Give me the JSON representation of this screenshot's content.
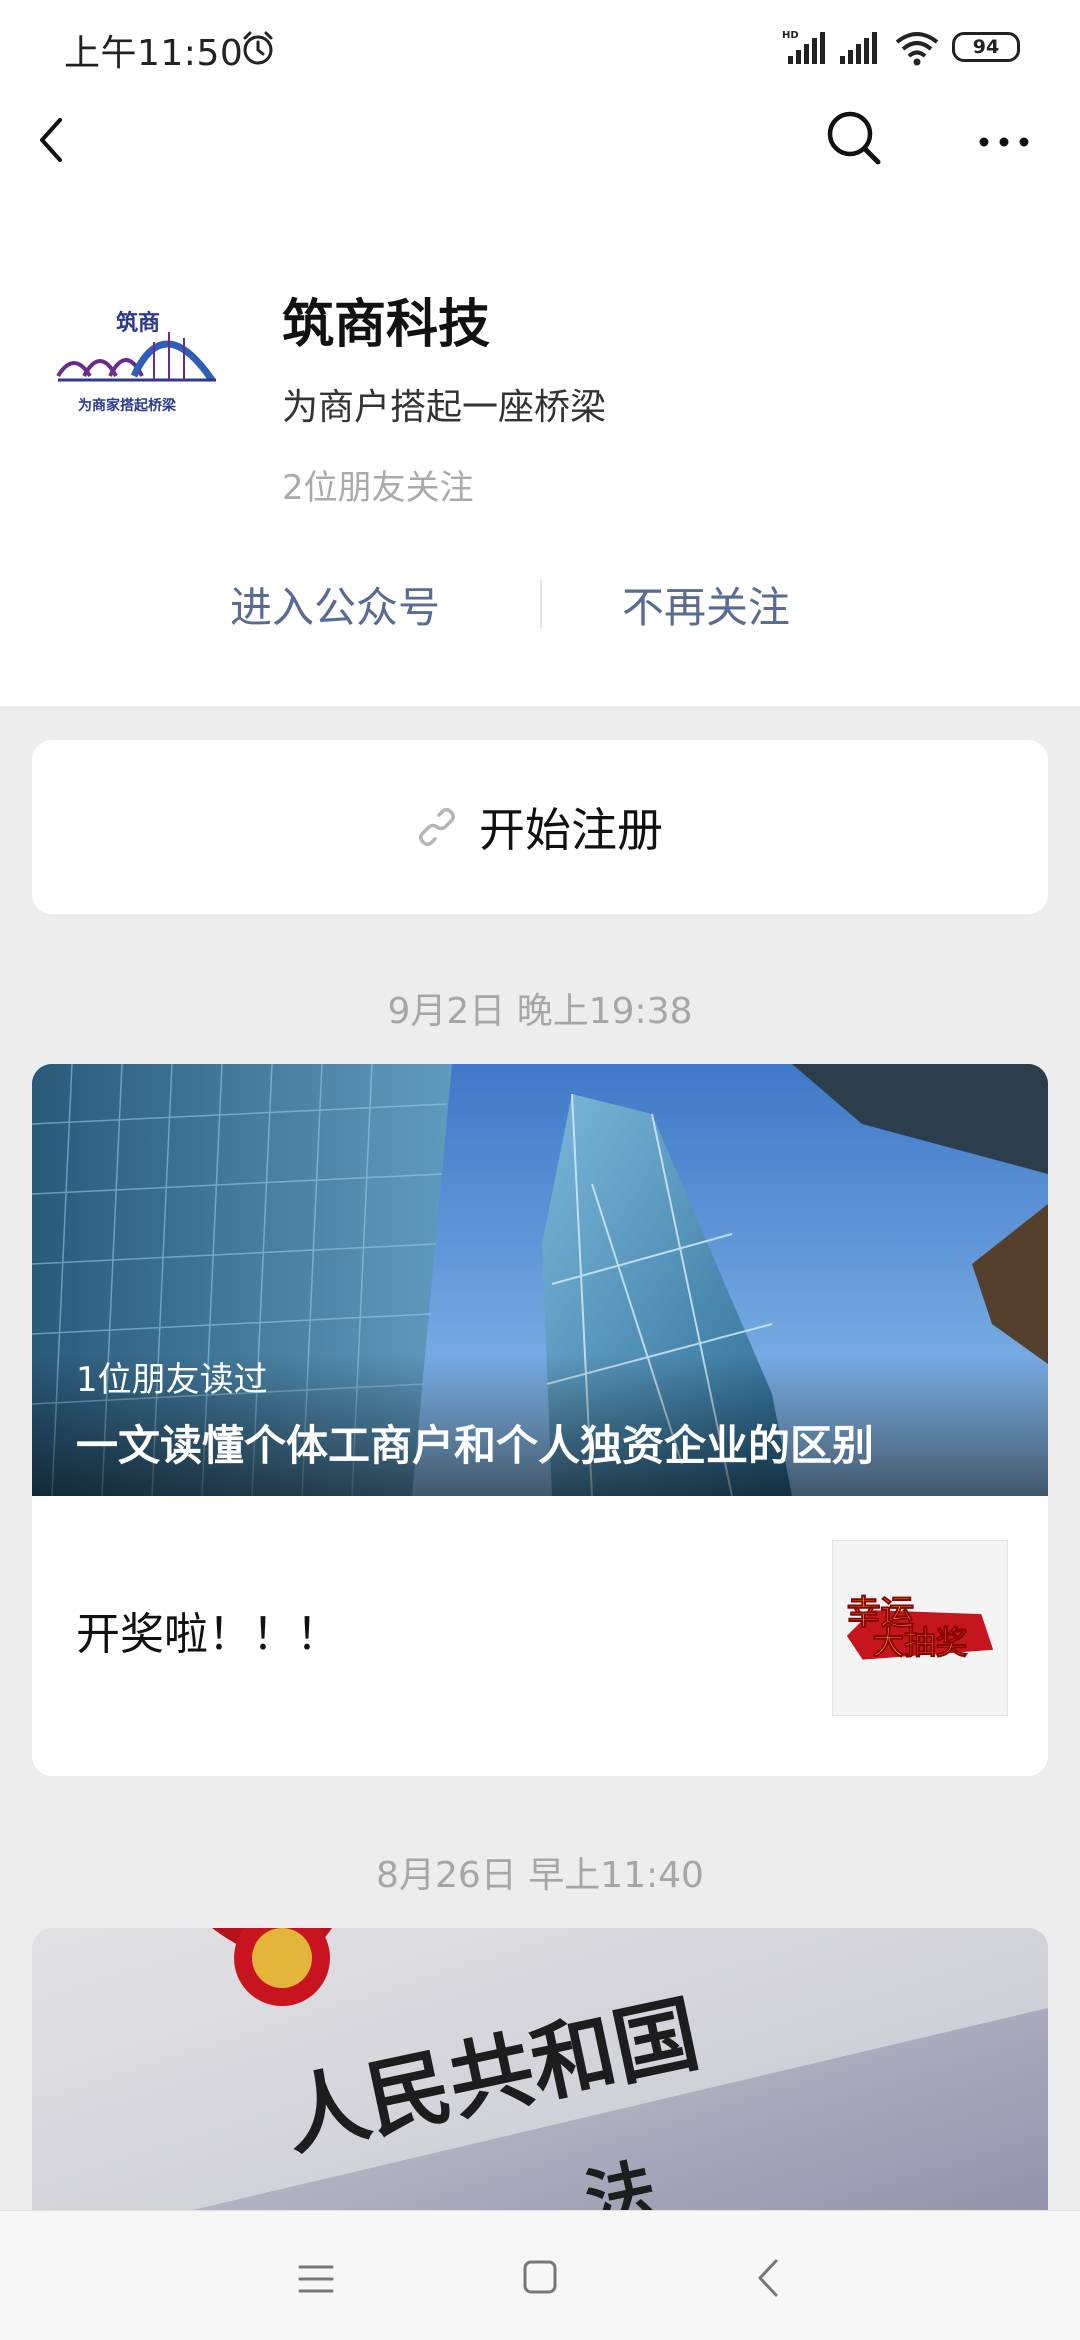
{
  "status_bar": {
    "time": "上午11:50",
    "battery": "94",
    "icons": [
      "alarm-icon",
      "hd-signal-icon",
      "signal-icon",
      "wifi-icon",
      "battery-icon"
    ]
  },
  "nav": {
    "back_icon": "chevron-left-icon",
    "search_icon": "search-icon",
    "more_icon": "more-dots-icon"
  },
  "profile": {
    "name": "筑商科技",
    "description": "为商户搭起一座桥梁",
    "followers": "2位朋友关注",
    "logo_text_top": "筑商",
    "logo_text_bottom": "为商家搭起桥梁"
  },
  "actions": {
    "enter": "进入公众号",
    "unfollow": "不再关注"
  },
  "register": {
    "label": "开始注册",
    "icon": "link-icon"
  },
  "feed": [
    {
      "timestamp": "9月2日 晚上19:38",
      "main_article": {
        "read_by": "1位朋友读过",
        "title": "一文读懂个体工商户和个人独资企业的区别"
      },
      "sub_article": {
        "title": "开奖啦！！！",
        "thumb_text_1": "幸运",
        "thumb_text_2": "大抽奖"
      }
    },
    {
      "timestamp": "8月26日 早上11:40",
      "cover_text_1": "人民共和国",
      "cover_text_2": "法"
    }
  ],
  "colors": {
    "link_blue": "#576b95",
    "background": "#ededed",
    "muted_text": "#a6a6a6"
  }
}
